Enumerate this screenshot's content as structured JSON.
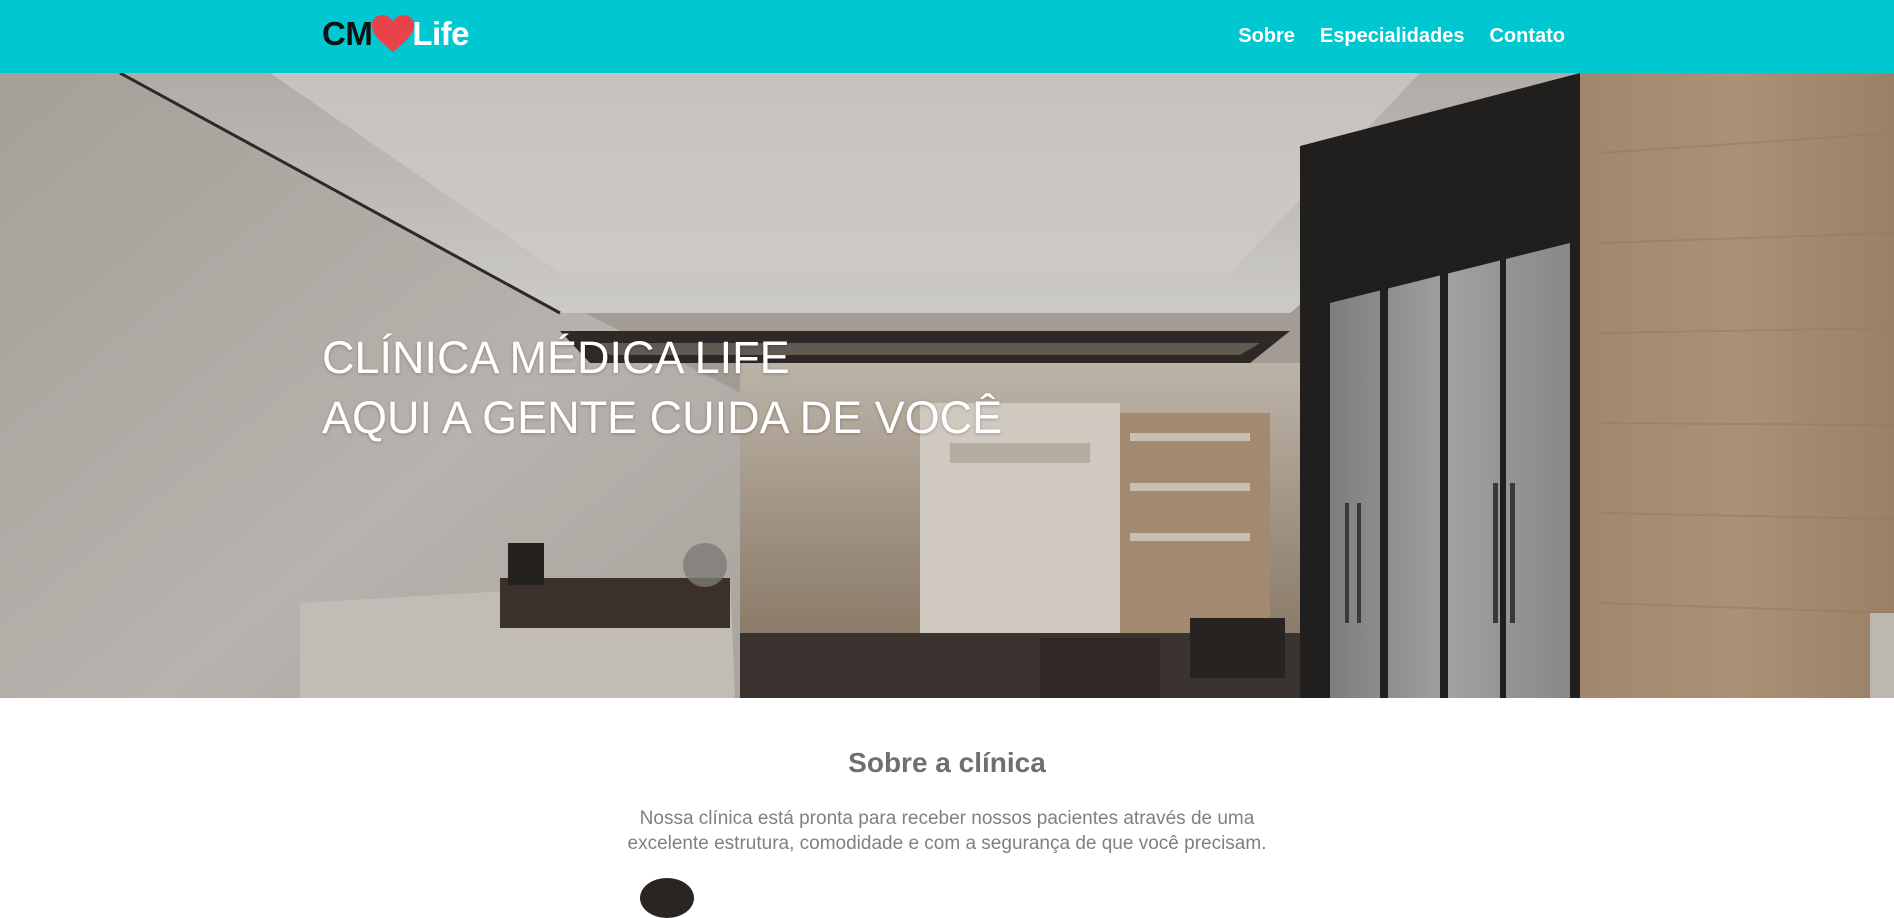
{
  "header": {
    "logo": {
      "prefix": "CM",
      "icon": "heart-icon",
      "suffix": "Life"
    },
    "nav": [
      {
        "label": "Sobre"
      },
      {
        "label": "Especialidades"
      },
      {
        "label": "Contato"
      }
    ]
  },
  "hero": {
    "title_line1": "CLÍNICA MÉDICA LIFE",
    "title_line2": "AQUI A GENTE CUIDA DE VOCÊ"
  },
  "about": {
    "title": "Sobre a clínica",
    "text": "Nossa clínica está pronta para receber nossos pacientes através de uma excelente estrutura, comodidade e com a segurança de que você precisam."
  },
  "colors": {
    "header_bg": "#00c8d1",
    "logo_dark": "#111111",
    "heart": "#e8424b",
    "heading_gray": "#6f6f6f",
    "text_gray": "#808080"
  }
}
